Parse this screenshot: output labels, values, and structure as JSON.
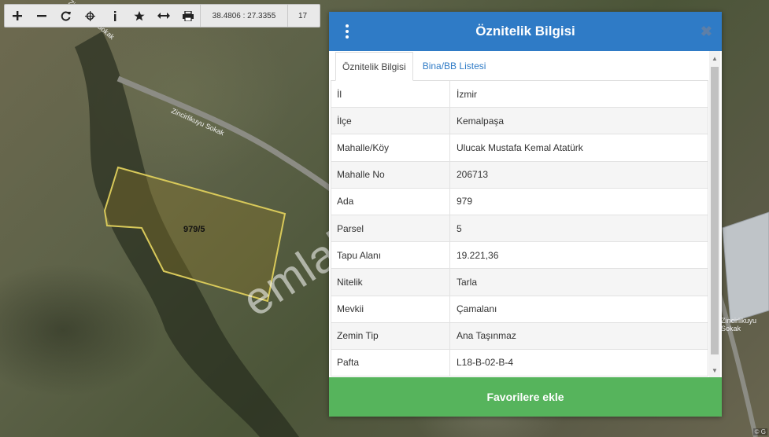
{
  "toolbar": {
    "buttons": [
      {
        "icon": "zoom-in-icon"
      },
      {
        "icon": "zoom-out-icon"
      },
      {
        "icon": "refresh-icon"
      },
      {
        "icon": "locate-icon"
      },
      {
        "icon": "info-icon"
      },
      {
        "icon": "star-icon"
      },
      {
        "icon": "measure-icon"
      },
      {
        "icon": "print-icon"
      }
    ],
    "coordinates": "38.4806 : 27.3355",
    "zoom_level": "17"
  },
  "map": {
    "parcel_label": "979/5",
    "road_labels": [
      "Zincirlikuyu Sokak",
      "Zincirlikuyu Sokak",
      "Zincirlikuyu Sokak"
    ],
    "watermark": "emlakjet.com",
    "corner_text": "© G"
  },
  "dialog": {
    "title": "Öznitelik Bilgisi",
    "tabs": [
      {
        "label": "Öznitelik Bilgisi",
        "active": true
      },
      {
        "label": "Bina/BB Listesi",
        "active": false
      }
    ],
    "rows": [
      {
        "key": "İl",
        "value": "İzmir"
      },
      {
        "key": "İlçe",
        "value": "Kemalpaşa"
      },
      {
        "key": "Mahalle/Köy",
        "value": "Ulucak Mustafa Kemal Atatürk"
      },
      {
        "key": "Mahalle No",
        "value": "206713"
      },
      {
        "key": "Ada",
        "value": "979"
      },
      {
        "key": "Parsel",
        "value": "5"
      },
      {
        "key": "Tapu Alanı",
        "value": "19.221,36"
      },
      {
        "key": "Nitelik",
        "value": "Tarla"
      },
      {
        "key": "Mevkii",
        "value": "Çamalanı"
      },
      {
        "key": "Zemin Tip",
        "value": "Ana Taşınmaz"
      },
      {
        "key": "Pafta",
        "value": "L18-B-02-B-4"
      }
    ],
    "favorite_button": "Favorilere ekle",
    "colors": {
      "header": "#2f7bc6",
      "button": "#56b45c",
      "tab_link": "#2f7bc6"
    }
  }
}
